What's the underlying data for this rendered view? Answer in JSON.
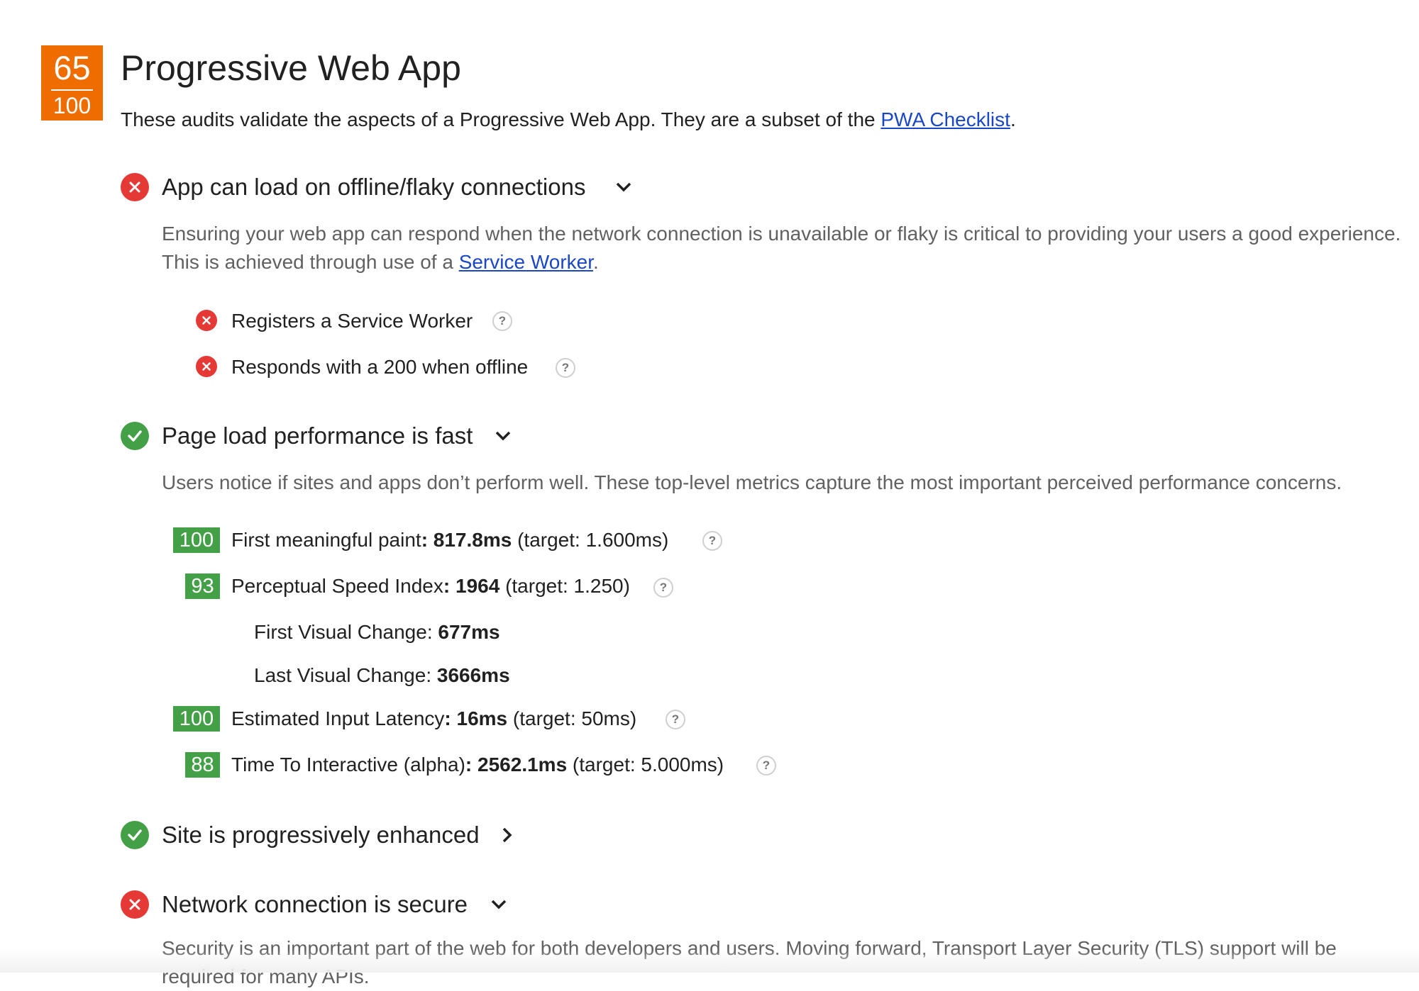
{
  "score": {
    "value": "65",
    "total": "100",
    "color": "#ef6c00"
  },
  "category": {
    "title": "Progressive Web App",
    "description_prefix": "These audits validate the aspects of a Progressive Web App. They are a subset of the ",
    "description_link": "PWA Checklist",
    "description_suffix": "."
  },
  "sections": [
    {
      "title": "App can load on offline/flaky connections",
      "status": "fail",
      "desc_prefix": "Ensuring your web app can respond when the network connection is unavailable or flaky is critical to providing your users a good experience. This is achieved through use of a ",
      "desc_link": "Service Worker",
      "desc_suffix": ".",
      "audits": [
        {
          "label": "Registers a Service Worker",
          "status": "fail"
        },
        {
          "label": "Responds with a 200 when offline",
          "status": "fail"
        }
      ]
    },
    {
      "title": "Page load performance is fast",
      "status": "pass",
      "description": "Users notice if sites and apps don’t perform well. These top-level metrics capture the most important perceived performance concerns.",
      "metrics": [
        {
          "score": "100",
          "name": "First meaningful paint",
          "value": ": 817.8ms",
          "target": " (target: 1.600ms)"
        },
        {
          "score": "93",
          "name": "Perceptual Speed Index",
          "value": ": 1964",
          "target": " (target: 1.250)"
        },
        {
          "score": "100",
          "name": "Estimated Input Latency",
          "value": ": 16ms",
          "target": " (target: 50ms)"
        },
        {
          "score": "88",
          "name": "Time To Interactive (alpha)",
          "value": ": 2562.1ms",
          "target": " (target: 5.000ms)"
        }
      ],
      "sub_metrics": [
        {
          "name": "First Visual Change: ",
          "value": "677ms"
        },
        {
          "name": "Last Visual Change: ",
          "value": "3666ms"
        }
      ]
    },
    {
      "title": "Site is progressively enhanced",
      "status": "pass"
    },
    {
      "title": "Network connection is secure",
      "status": "fail",
      "description": "Security is an important part of the web for both developers and users. Moving forward, Transport Layer Security (TLS) support will be required for many APIs."
    }
  ],
  "help_glyph": "?",
  "colors": {
    "fail": "#e53935",
    "pass": "#43a047",
    "link": "#1a47c4"
  },
  "icons": [
    "fail-x-icon",
    "pass-check-icon",
    "chevron-down-icon",
    "chevron-right-icon",
    "help-icon"
  ]
}
